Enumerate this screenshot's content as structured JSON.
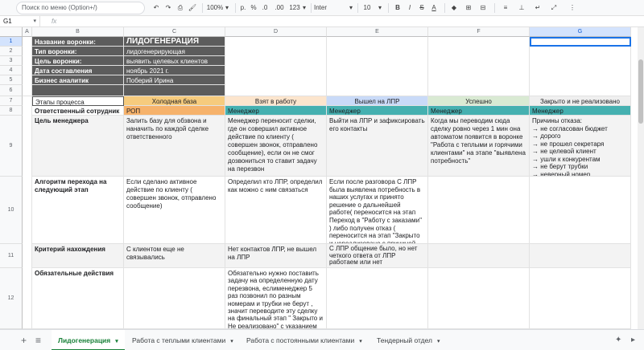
{
  "toolbar": {
    "search_placeholder": "Поиск по меню (Option+/)",
    "undo": "↶",
    "redo": "↷",
    "print": "⎙",
    "paint": "🖌",
    "zoom": "100%",
    "zoom_caret": "▾",
    "currency": "р.",
    "percent": "%",
    "dec_minus": ".0",
    "dec_plus": ".00",
    "format": "123",
    "format_caret": "▾",
    "font": "Inter",
    "font_caret": "▾",
    "size": "10",
    "size_caret": "▾",
    "bold": "B",
    "italic": "I",
    "strike": "S",
    "textcolor": "A",
    "fill": "◆",
    "borders": "⊞",
    "merge": "⊟",
    "halign": "≡",
    "valign": "⊥",
    "wrap": "↵",
    "rotate": "⤢",
    "more": "⋮"
  },
  "formula_bar": {
    "name_box": "G1",
    "name_caret": "▾",
    "fx": "fx",
    "value": ""
  },
  "columns": [
    "A",
    "B",
    "C",
    "D",
    "E",
    "F",
    "G"
  ],
  "rows": [
    "1",
    "2",
    "3",
    "4",
    "5",
    "6",
    "7",
    "8",
    "9",
    "10",
    "11",
    "12"
  ],
  "info": {
    "funnel_name_label": "Название воронки:",
    "funnel_name": "ЛИДОГЕНЕРАЦИЯ",
    "funnel_type_label": "Тип воронки:",
    "funnel_type": "лидогенерирующая",
    "funnel_goal_label": "Цель воронки:",
    "funnel_goal": "выявить целевых клиентов",
    "date_label": "Дата составления",
    "date": "ноябрь 2021 г.",
    "analyst_label": "Бизнес аналитик",
    "analyst": "Поберий Ирина"
  },
  "stages": {
    "label": "Этапы процесса",
    "items": [
      "Холодная база",
      "Взят в работу",
      "Вышел на ЛПР",
      "Успешно",
      "Закрыто и не реализовано"
    ],
    "colors": [
      "#f6cb7d",
      "#fce5cd",
      "#c9daf8",
      "#d9ead3",
      "#efefef"
    ]
  },
  "responsible": {
    "label": "Ответственный сотрудник",
    "items": [
      "РОП",
      "Менеджер",
      "Менеджер",
      "Менеджер",
      "Менеджер"
    ],
    "colors": [
      "#f6b26b",
      "#45b0b0",
      "#45b0b0",
      "#45b0b0",
      "#45b0b0"
    ]
  },
  "goal": {
    "label": "Цель менеджера",
    "items": [
      "Залить базу для обзвона и наначить по каждой сделке ответственного",
      "Менеджер переносит сделки, где он совершил активное действие по клиенту ( совершен звонок, отправлено сообщение), если он не смог дозвониться то ставит задачу на  перезвон",
      "Выйти на ЛПР и зафиксировать его контакты",
      "Когда мы переводим сюда сделку ровно через 1 мин она автоматом появится в воронке \"Работа с теплыми и горячими клиентами\" на этапе \"выявлена потребность\"",
      "Причины отказа:\n→ не согласован бюджет\n→ дорого\n→ не прошел секретаря\n→ не целевой клиент\n→ ушли к конкурентам\n→ не берут трубки\n→ неверный номер"
    ]
  },
  "algorithm": {
    "label": "Алгоритм перехода на следующий этап",
    "items": [
      "Если сделано активное действие по клиенту ( совершен звонок, отправлено сообщение)",
      "Определил кто ЛПР, определил как можно с ним связаться",
      "Если после разговора С ЛПР была выявлена потребность в наших услугах и принято решение о дальнейшей работе( переносится на  этап  Переход в \"Работу с заказами\" ) либо получен  отказ ( переносится на этап \"Закрыто и нереализовано с причиной отказа)",
      "",
      ""
    ]
  },
  "criterion": {
    "label": "Критерий нахождения",
    "items": [
      "С клиентом еще не связывались",
      "Нет контактов ЛПР, не вышел на ЛПР",
      "С ЛПР общение было, но нет четкого ответа от ЛПР  работаем или нет",
      "",
      ""
    ]
  },
  "mandatory": {
    "label": "Обязательные действия",
    "items": [
      "",
      "Обязательно нужно поставить задачу на определенную дату перезвона, еслименеджер 5 раз позвонил по разным номерам и трубки не берут , значит переводите эту сделку на финальный этап \" Закрыто и Не реализовано\" с  указанием",
      "",
      "",
      ""
    ]
  },
  "sheets": {
    "add": "+",
    "list": "≡",
    "tabs": [
      "Лидогенерация",
      "Работа с теплыми клиентами",
      "Работа с постоянными клиентами",
      "Тендерный отдел"
    ],
    "caret": "▾",
    "explore": "✦",
    "collapse": "▸"
  }
}
